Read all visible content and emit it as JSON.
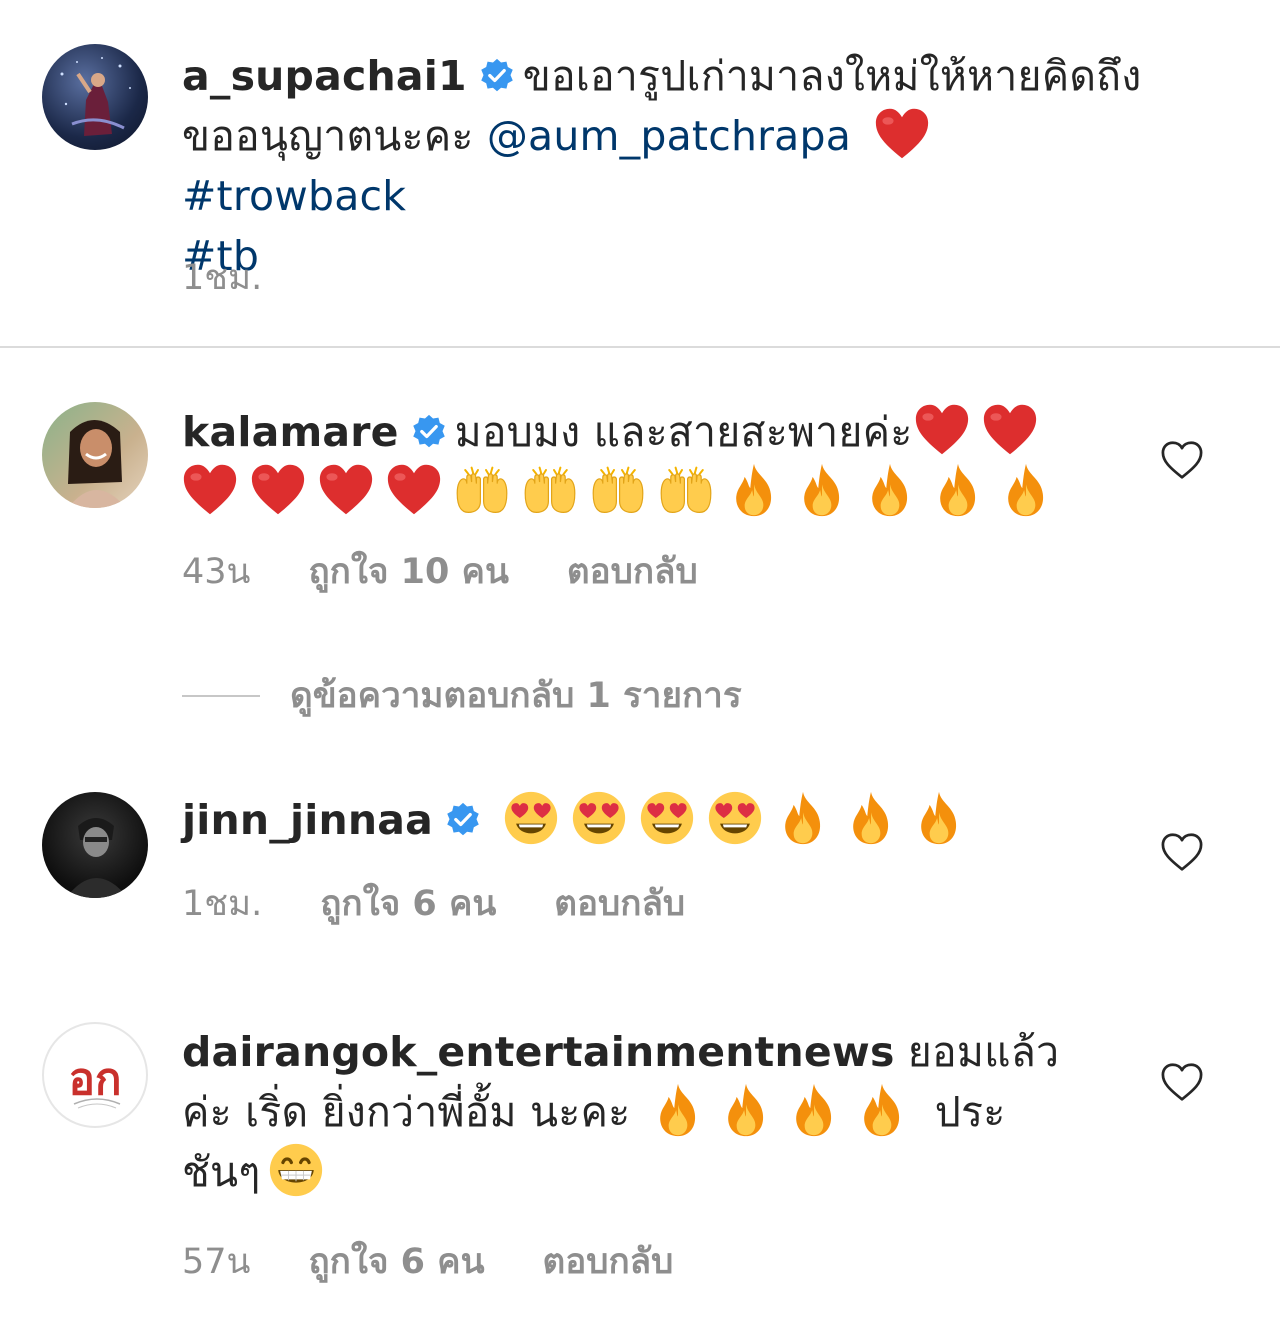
{
  "post": {
    "username": "a_supachai1",
    "caption_line1": "ขอเอารูปเก่ามาลงใหม่ให้หายคิดถึง",
    "caption_line2_text": "ขออนุญาตนะคะ ",
    "mention": "@aum_patchrapa",
    "hashtag1": "#trowback",
    "hashtag2": "#tb",
    "time": "1ชม."
  },
  "comments": [
    {
      "username": "kalamare",
      "text": "มอบมง และสายสะพายค่ะ",
      "time": "43น",
      "likes": "ถูกใจ 10 คน",
      "reply": "ตอบกลับ"
    },
    {
      "username": "jinn_jinnaa",
      "time": "1ชม.",
      "likes": "ถูกใจ 6 คน",
      "reply": "ตอบกลับ"
    },
    {
      "username": "dairangok_entertainmentnews",
      "text1": "ยอมแล้ว",
      "text2": "ค่ะ  เริ่ด ยิ่งกว่าพี่อั้ม นะคะ",
      "text3": "ประ",
      "text4": "ชันๆ",
      "avatar_text": "อก",
      "time": "57น",
      "likes": "ถูกใจ 6 คน",
      "reply": "ตอบกลับ"
    }
  ],
  "view_replies": "ดูข้อความตอบกลับ 1 รายการ",
  "colors": {
    "verified": "#3897f0",
    "link": "#00376b",
    "meta": "#8e8e8e",
    "divider": "#dbdbdb"
  },
  "icons": [
    "verified-badge-icon",
    "heart-emoji",
    "raising-hands-emoji",
    "fire-emoji",
    "heart-eyes-emoji",
    "grinning-emoji",
    "like-heart-icon"
  ]
}
